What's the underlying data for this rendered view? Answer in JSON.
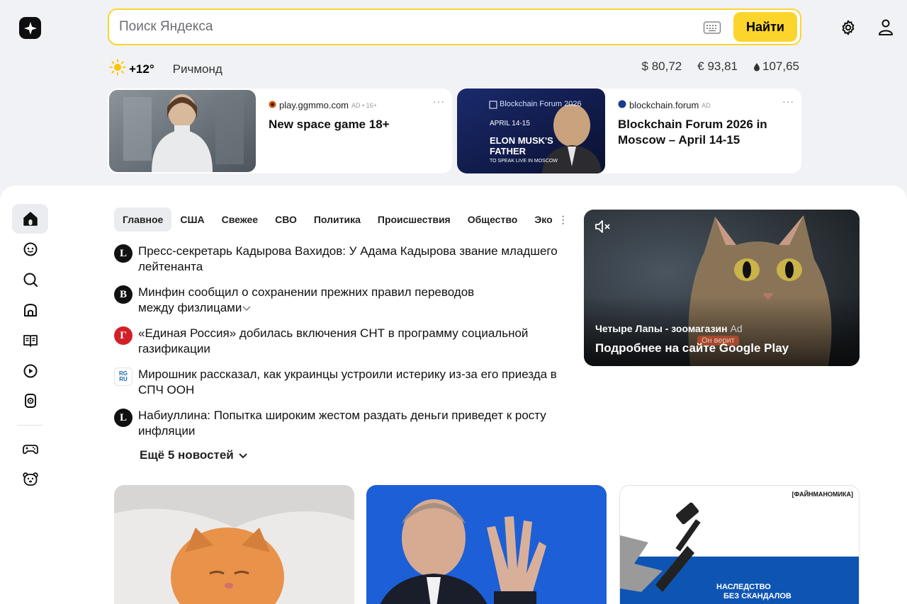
{
  "search": {
    "placeholder": "Поиск Яндекса",
    "button_label": "Найти"
  },
  "weather": {
    "temp": "+12°",
    "city": "Ричмонд"
  },
  "rates": [
    {
      "label": "$ 80,72"
    },
    {
      "label": "€ 93,81"
    },
    {
      "label": "107,65"
    }
  ],
  "ads": [
    {
      "source": "play.ggmmo.com",
      "label": "AD • 16+",
      "title": "New space game 18+",
      "more": "···"
    },
    {
      "source": "blockchain.forum",
      "label": "AD",
      "title": "Blockchain Forum 2026 in Moscow – April 14-15",
      "more": "···",
      "image_text": {
        "title": "Blockchain Forum 2026",
        "date": "APRIL 14-15",
        "headline": "ELON MUSK'S FATHER",
        "sub": "TO SPEAK LIVE IN MOSCOW"
      }
    }
  ],
  "tabs": [
    "Главное",
    "США",
    "Свежее",
    "СВО",
    "Политика",
    "Происшествия",
    "Общество",
    "Эко"
  ],
  "news": [
    {
      "icon": "L",
      "icon_color": "#111111",
      "text": "Пресс-секретарь Кадырова Вахидов: У Адама Кадырова звание младшего лейтенанта"
    },
    {
      "icon": "B",
      "icon_color": "#111111",
      "text": "Минфин сообщил о сохранении прежних правил переводов между физлицами"
    },
    {
      "icon": "Г",
      "icon_color": "#d32027",
      "text": "«Единая Россия» добилась включения СНТ в программу социальной газификации"
    },
    {
      "icon": "RG RU",
      "icon_color": "#ffffff",
      "text": "Мирошник рассказал, как украинцы устроили истерику из-за его приезда в СПЧ ООН"
    },
    {
      "icon": "L",
      "icon_color": "#111111",
      "text": "Набиуллина: Попытка широким жестом раздать деньги приведет к росту инфляции"
    }
  ],
  "more_news": "Ещё 5 новостей",
  "video_ad": {
    "advertiser": "Четыре Лапы - зоомагазин",
    "ad_label": "Ad",
    "cta": "Подробнее на сайте Google Play",
    "badge": "Он верит"
  },
  "cards": [
    {
      "label": ""
    },
    {
      "label": ""
    },
    {
      "tag": "[ФАЙНМАНОМИКА]",
      "caption_line1": "НАСЛЕДСТВО",
      "caption_line2": "БЕЗ СКАНДАЛОВ"
    }
  ],
  "colors": {
    "accent": "#fcd52c",
    "background": "#f1f2f5"
  }
}
